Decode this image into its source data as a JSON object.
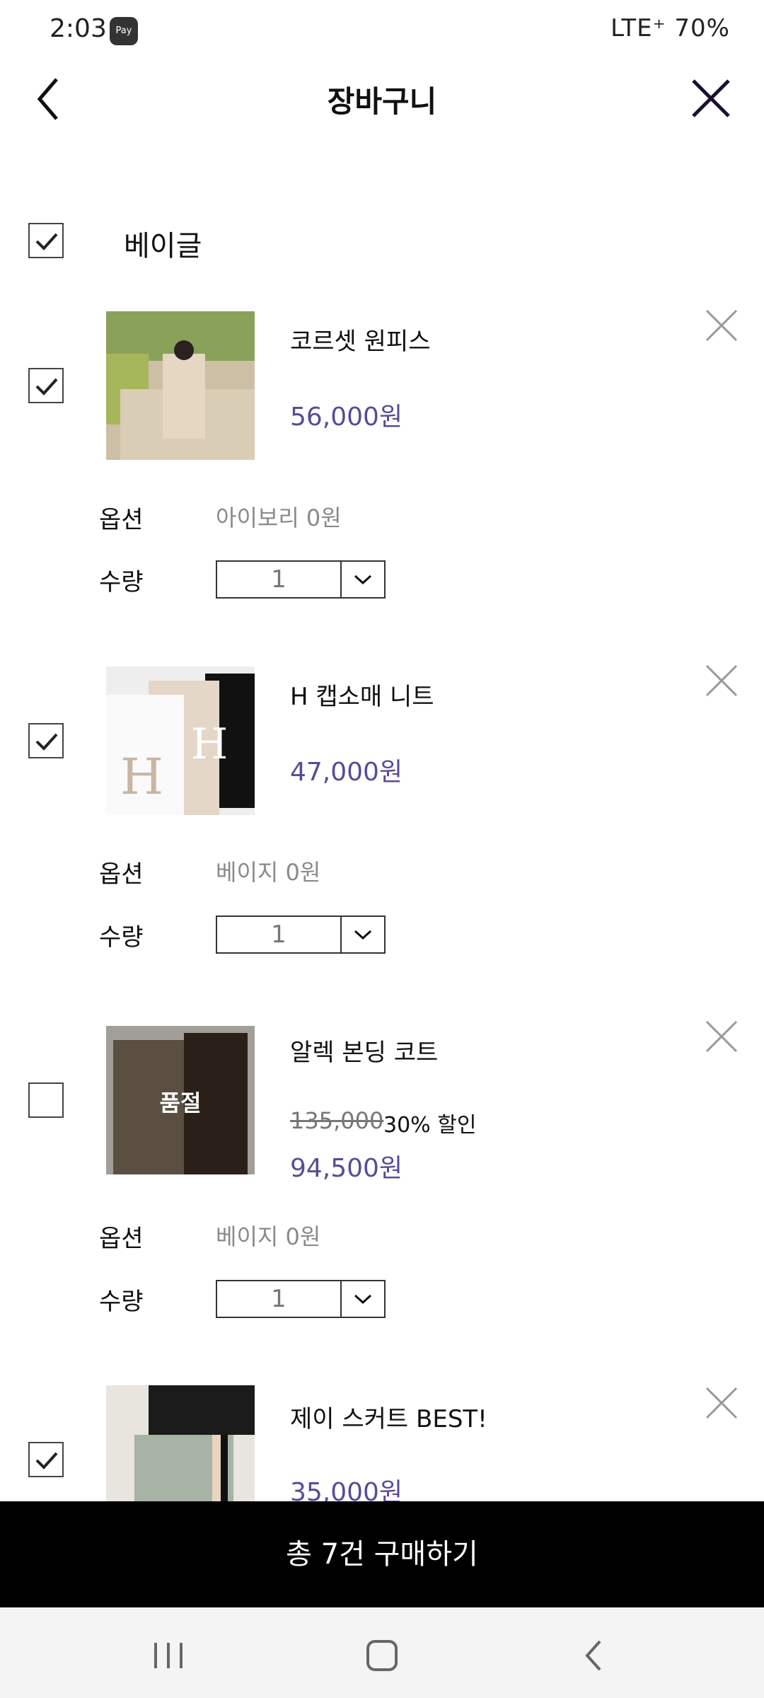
{
  "status": {
    "time": "2:03",
    "pay": "Pay",
    "right_text": "LTE⁺ 70%"
  },
  "header": {
    "title": "장바구니"
  },
  "store": {
    "name": "베이글"
  },
  "labels": {
    "option": "옵션",
    "quantity": "수량",
    "soldout": "품절"
  },
  "items": [
    {
      "name": "코르셋 원피스",
      "price": "56,000원",
      "option": "아이보리 0원",
      "qty": "1",
      "checked": true
    },
    {
      "name": "H 캡소매 니트",
      "price": "47,000원",
      "option": "베이지 0원",
      "qty": "1",
      "checked": true
    },
    {
      "name": "알렉 본딩 코트",
      "original_price": "135,000",
      "discount": "30% 할인",
      "price": "94,500원",
      "option": "베이지 0원",
      "qty": "1",
      "checked": false,
      "soldout": true
    },
    {
      "name": "제이 스커트 BEST!",
      "price": "35,000원",
      "checked": true
    }
  ],
  "buy_button": "총 7건 구매하기",
  "colors": {
    "price": "#5b4a96",
    "primary_button": "#000000"
  }
}
